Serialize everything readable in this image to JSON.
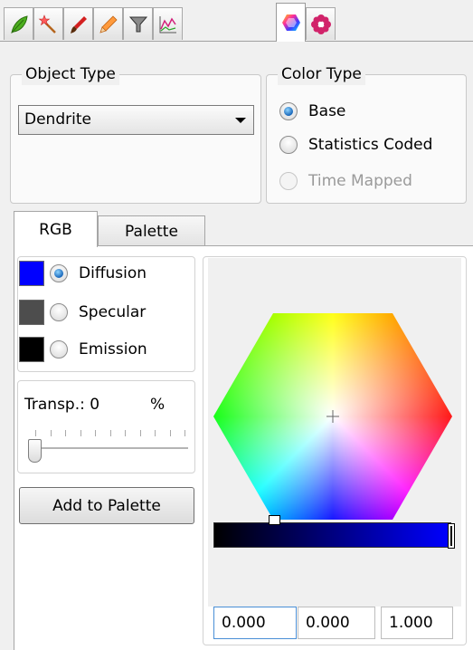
{
  "toolbar": {
    "tabs": [
      {
        "icon": "leaf-icon",
        "active": false
      },
      {
        "icon": "magic-wand-icon",
        "active": false
      },
      {
        "icon": "brush-icon",
        "active": false
      },
      {
        "icon": "pencil-icon",
        "active": false
      },
      {
        "icon": "filter-icon",
        "active": false
      },
      {
        "icon": "statistics-chart-icon",
        "active": false
      },
      {
        "icon": "color-wheel-icon",
        "active": true
      },
      {
        "icon": "gear-flower-icon",
        "active": false
      }
    ]
  },
  "object_type": {
    "title": "Object Type",
    "selected": "Dendrite"
  },
  "color_type": {
    "title": "Color Type",
    "options": [
      {
        "label": "Base",
        "checked": true,
        "enabled": true
      },
      {
        "label": "Statistics Coded",
        "checked": false,
        "enabled": true
      },
      {
        "label": "Time Mapped",
        "checked": false,
        "enabled": false
      }
    ]
  },
  "tabs": {
    "rgb": "RGB",
    "palette": "Palette",
    "active": "RGB"
  },
  "material": {
    "options": [
      {
        "label": "Diffusion",
        "color": "#0000ff",
        "checked": true
      },
      {
        "label": "Specular",
        "color": "#4d4d4d",
        "checked": false
      },
      {
        "label": "Emission",
        "color": "#000000",
        "checked": false
      }
    ]
  },
  "transparency": {
    "label": "Transp.:",
    "value": "0",
    "unit": "%",
    "slider_fraction": 0
  },
  "add_to_palette": "Add to Palette",
  "color_picker": {
    "value_strip_fraction": 1.0,
    "rgb_values": [
      "0.000",
      "0.000",
      "1.000"
    ]
  }
}
